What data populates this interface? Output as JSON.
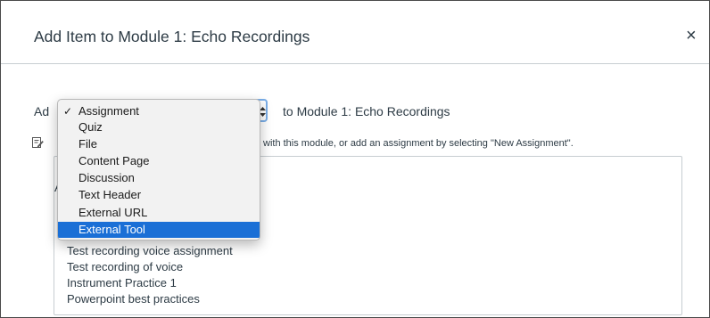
{
  "modal": {
    "title": "Add Item to Module 1: Echo Recordings",
    "close_label": "×"
  },
  "add_row": {
    "prefix": "Ad",
    "suffix": "to Module 1: Echo Recordings",
    "selected_type": "Assignment"
  },
  "help": {
    "icon": "edit-icon",
    "text": "with this module, or add an assignment by selecting \"New Assignment\"."
  },
  "list": {
    "partial_chars": [
      "[",
      "A"
    ],
    "items": [
      "Test recording voice assignment",
      "Test recording of voice",
      "Instrument Practice 1",
      "Powerpoint best practices"
    ]
  },
  "dropdown": {
    "check_glyph": "✓",
    "options": [
      "Assignment",
      "Quiz",
      "File",
      "Content Page",
      "Discussion",
      "Text Header",
      "External URL",
      "External Tool"
    ],
    "checked_index": 0,
    "highlighted_index": 7,
    "highlight_color": "#1a6fd6"
  }
}
